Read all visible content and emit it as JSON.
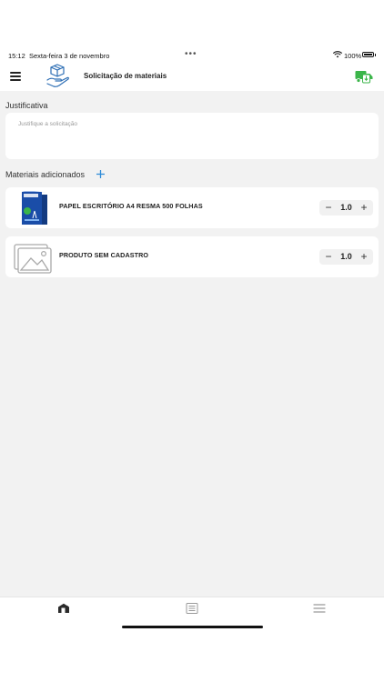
{
  "status_bar": {
    "time": "15:12",
    "date": "Sexta-feira 3 de novembro",
    "dots": "•••",
    "battery": "100%"
  },
  "header": {
    "title": "Solicitação de materiais",
    "menu_icon": "hamburger-menu-icon",
    "logo_icon": "hand-holding-box-icon",
    "action_icon": "truck-download-icon"
  },
  "justification": {
    "label": "Justificativa",
    "placeholder": "Justifique a solicitação",
    "value": ""
  },
  "materials": {
    "label": "Materiais adicionados",
    "add_icon": "plus-icon",
    "items": [
      {
        "name": "PAPEL ESCRITÓRIO A4 RESMA 500 FOLHAS",
        "quantity": "1.0",
        "thumb": "paper-ream-image"
      },
      {
        "name": "PRODUTO SEM CADASTRO",
        "quantity": "1.0",
        "thumb": "image-placeholder-icon"
      }
    ],
    "minus": "−",
    "plus": "+"
  },
  "tabbar": {
    "tabs": [
      "home-icon",
      "list-icon",
      "menu-icon"
    ]
  },
  "colors": {
    "accent_green": "#3bb54a",
    "accent_blue": "#2e8bd8",
    "background": "#f2f2f2"
  }
}
